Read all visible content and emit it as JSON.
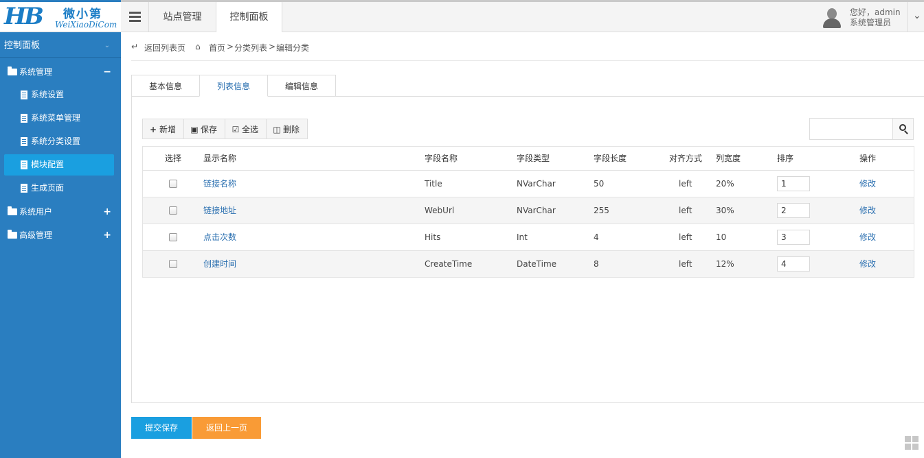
{
  "logo": {
    "mark": "HB",
    "name_cn": "微小第",
    "name_en": "WeiXiaoDiCom"
  },
  "sidebar": {
    "header": "控制面板",
    "groups": [
      {
        "label": "系统管理",
        "sign": "−",
        "items": [
          "系统设置",
          "系统菜单管理",
          "系统分类设置",
          "模块配置",
          "生成页面"
        ],
        "active_item": "模块配置"
      },
      {
        "label": "系统用户",
        "sign": "+"
      },
      {
        "label": "高级管理",
        "sign": "+"
      }
    ]
  },
  "header": {
    "tabs": [
      "站点管理",
      "控制面板"
    ],
    "user_greeting": "您好，admin",
    "user_role": "系统管理员"
  },
  "breadcrumb": {
    "back": "返回列表页",
    "home": "首页",
    "sep1": ">",
    "list": "分类列表",
    "sep2": ">",
    "current": "编辑分类"
  },
  "tabs": {
    "items": [
      "基本信息",
      "列表信息",
      "编辑信息"
    ],
    "active": "列表信息"
  },
  "toolbar": {
    "add": "新增",
    "save": "保存",
    "select_all": "全选",
    "delete": "删除",
    "search_placeholder": ""
  },
  "table": {
    "columns": [
      "选择",
      "显示名称",
      "字段名称",
      "字段类型",
      "字段长度",
      "对齐方式",
      "列宽度",
      "排序",
      "操作"
    ],
    "rows": [
      {
        "display": "链接名称",
        "field": "Title",
        "type": "NVarChar",
        "length": "50",
        "align": "left",
        "width": "20%",
        "sort": "1",
        "action": "修改"
      },
      {
        "display": "链接地址",
        "field": "WebUrl",
        "type": "NVarChar",
        "length": "255",
        "align": "left",
        "width": "30%",
        "sort": "2",
        "action": "修改"
      },
      {
        "display": "点击次数",
        "field": "Hits",
        "type": "Int",
        "length": "4",
        "align": "left",
        "width": "10",
        "sort": "3",
        "action": "修改"
      },
      {
        "display": "创建时间",
        "field": "CreateTime",
        "type": "DateTime",
        "length": "8",
        "align": "left",
        "width": "12%",
        "sort": "4",
        "action": "修改"
      }
    ]
  },
  "buttons": {
    "submit": "提交保存",
    "back": "返回上一页"
  },
  "colors": {
    "sidebar": "#2a7ec0",
    "active_item": "#1a9fe0",
    "submit": "#1a9fe0",
    "back": "#f99b36",
    "link": "#2a6fb0"
  }
}
